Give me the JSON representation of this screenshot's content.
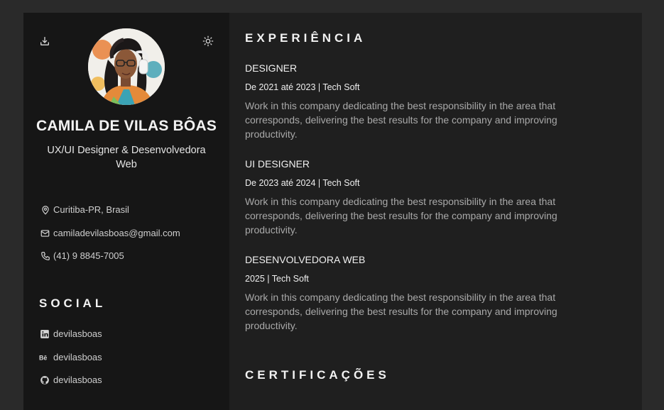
{
  "profile": {
    "name": "CAMILA DE VILAS BÔAS",
    "role": "UX/UI Designer & Desenvolvedora Web"
  },
  "contact": {
    "location": "Curitiba-PR, Brasil",
    "email": "camiladevilasboas@gmail.com",
    "phone": "(41) 9 8845-7005"
  },
  "social": {
    "title": "SOCIAL",
    "items": [
      {
        "label": "devilasboas",
        "icon": "linkedin-icon"
      },
      {
        "label": "devilasboas",
        "icon": "behance-icon"
      },
      {
        "label": "devilasboas",
        "icon": "github-icon"
      }
    ]
  },
  "experience": {
    "title": "EXPERIÊNCIA",
    "jobs": [
      {
        "title": "DESIGNER",
        "period": "De 2021 até 2023 | Tech Soft",
        "description": "Work in this company dedicating the best responsibility in the area that corresponds, delivering the best results for the company and improving productivity."
      },
      {
        "title": "UI DESIGNER",
        "period": "De 2023 até 2024 | Tech Soft",
        "description": "Work in this company dedicating the best responsibility in the area that corresponds, delivering the best results for the company and improving productivity."
      },
      {
        "title": "DESENVOLVEDORA WEB",
        "period": "2025 | Tech Soft",
        "description": "Work in this company dedicating the best responsibility in the area that corresponds, delivering the best results for the company and improving productivity."
      }
    ]
  },
  "certifications": {
    "title": "CERTIFICAÇÕES"
  },
  "icons": {
    "download": "download-icon",
    "theme": "sun-icon",
    "location": "map-pin-icon",
    "email": "mail-icon",
    "phone": "phone-icon"
  },
  "colors": {
    "page_background": "#2a2a2a",
    "sidebar_background": "#161616",
    "main_background": "#1f1f1f",
    "text_primary": "#f2f2f2",
    "text_secondary": "#a9a9a9"
  }
}
